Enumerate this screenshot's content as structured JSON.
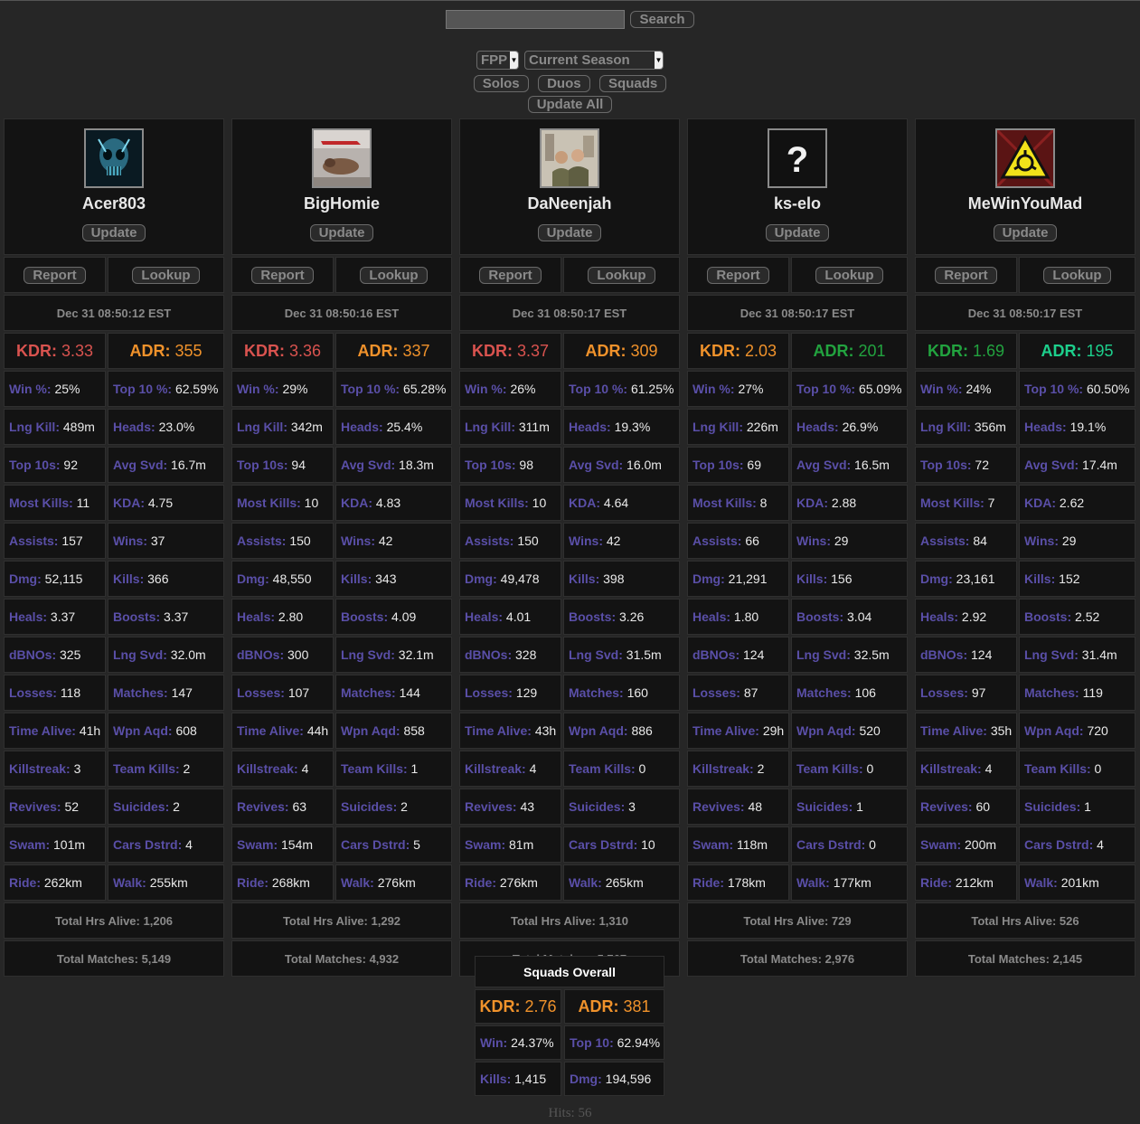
{
  "search": {
    "placeholder": "",
    "button": "Search"
  },
  "filters": {
    "perspective": "FPP",
    "season": "Current Season",
    "modes": [
      "Solos",
      "Duos",
      "Squads"
    ],
    "update_all": "Update All"
  },
  "labels": {
    "update": "Update",
    "report": "Report",
    "lookup": "Lookup",
    "kdr": "KDR:",
    "adr": "ADR:",
    "total_hrs_prefix": "Total Hrs Alive:",
    "total_matches_prefix": "Total Matches:"
  },
  "players": [
    {
      "name": "Acer803",
      "avatar": "skull-avatar",
      "updated": "Dec 31 08:50:12 EST",
      "kdr": "3.33",
      "adr": "355",
      "kdr_color": "#d9534f",
      "adr_color": "#f0922b",
      "stats": [
        [
          "Win %:",
          "25%",
          "Top 10 %:",
          "62.59%"
        ],
        [
          "Lng Kill:",
          "489m",
          "Heads:",
          "23.0%"
        ],
        [
          "Top 10s:",
          "92",
          "Avg Svd:",
          "16.7m"
        ],
        [
          "Most Kills:",
          "11",
          "KDA:",
          "4.75"
        ],
        [
          "Assists:",
          "157",
          "Wins:",
          "37"
        ],
        [
          "Dmg:",
          "52,115",
          "Kills:",
          "366"
        ],
        [
          "Heals:",
          "3.37",
          "Boosts:",
          "3.37"
        ],
        [
          "dBNOs:",
          "325",
          "Lng Svd:",
          "32.0m"
        ],
        [
          "Losses:",
          "118",
          "Matches:",
          "147"
        ],
        [
          "Time Alive:",
          "41h",
          "Wpn Aqd:",
          "608"
        ],
        [
          "Killstreak:",
          "3",
          "Team Kills:",
          "2"
        ],
        [
          "Revives:",
          "52",
          "Suicides:",
          "2"
        ],
        [
          "Swam:",
          "101m",
          "Cars Dstrd:",
          "4"
        ],
        [
          "Ride:",
          "262km",
          "Walk:",
          "255km"
        ]
      ],
      "total_hrs": "1,206",
      "total_matches": "5,149"
    },
    {
      "name": "BigHomie",
      "avatar": "photo-avatar",
      "updated": "Dec 31 08:50:16 EST",
      "kdr": "3.36",
      "adr": "337",
      "kdr_color": "#d9534f",
      "adr_color": "#f0922b",
      "stats": [
        [
          "Win %:",
          "29%",
          "Top 10 %:",
          "65.28%"
        ],
        [
          "Lng Kill:",
          "342m",
          "Heads:",
          "25.4%"
        ],
        [
          "Top 10s:",
          "94",
          "Avg Svd:",
          "18.3m"
        ],
        [
          "Most Kills:",
          "10",
          "KDA:",
          "4.83"
        ],
        [
          "Assists:",
          "150",
          "Wins:",
          "42"
        ],
        [
          "Dmg:",
          "48,550",
          "Kills:",
          "343"
        ],
        [
          "Heals:",
          "2.80",
          "Boosts:",
          "4.09"
        ],
        [
          "dBNOs:",
          "300",
          "Lng Svd:",
          "32.1m"
        ],
        [
          "Losses:",
          "107",
          "Matches:",
          "144"
        ],
        [
          "Time Alive:",
          "44h",
          "Wpn Aqd:",
          "858"
        ],
        [
          "Killstreak:",
          "4",
          "Team Kills:",
          "1"
        ],
        [
          "Revives:",
          "63",
          "Suicides:",
          "2"
        ],
        [
          "Swam:",
          "154m",
          "Cars Dstrd:",
          "5"
        ],
        [
          "Ride:",
          "268km",
          "Walk:",
          "276km"
        ]
      ],
      "total_hrs": "1,292",
      "total_matches": "4,932"
    },
    {
      "name": "DaNeenjah",
      "avatar": "soldiers-avatar",
      "updated": "Dec 31 08:50:17 EST",
      "kdr": "3.37",
      "adr": "309",
      "kdr_color": "#d9534f",
      "adr_color": "#f0922b",
      "stats": [
        [
          "Win %:",
          "26%",
          "Top 10 %:",
          "61.25%"
        ],
        [
          "Lng Kill:",
          "311m",
          "Heads:",
          "19.3%"
        ],
        [
          "Top 10s:",
          "98",
          "Avg Svd:",
          "16.0m"
        ],
        [
          "Most Kills:",
          "10",
          "KDA:",
          "4.64"
        ],
        [
          "Assists:",
          "150",
          "Wins:",
          "42"
        ],
        [
          "Dmg:",
          "49,478",
          "Kills:",
          "398"
        ],
        [
          "Heals:",
          "4.01",
          "Boosts:",
          "3.26"
        ],
        [
          "dBNOs:",
          "328",
          "Lng Svd:",
          "31.5m"
        ],
        [
          "Losses:",
          "129",
          "Matches:",
          "160"
        ],
        [
          "Time Alive:",
          "43h",
          "Wpn Aqd:",
          "886"
        ],
        [
          "Killstreak:",
          "4",
          "Team Kills:",
          "0"
        ],
        [
          "Revives:",
          "43",
          "Suicides:",
          "3"
        ],
        [
          "Swam:",
          "81m",
          "Cars Dstrd:",
          "10"
        ],
        [
          "Ride:",
          "276km",
          "Walk:",
          "265km"
        ]
      ],
      "total_hrs": "1,310",
      "total_matches": "5,767"
    },
    {
      "name": "ks-elo",
      "avatar": "question-mark-avatar",
      "updated": "Dec 31 08:50:17 EST",
      "kdr": "2.03",
      "adr": "201",
      "kdr_color": "#f0922b",
      "adr_color": "#22a33f",
      "stats": [
        [
          "Win %:",
          "27%",
          "Top 10 %:",
          "65.09%"
        ],
        [
          "Lng Kill:",
          "226m",
          "Heads:",
          "26.9%"
        ],
        [
          "Top 10s:",
          "69",
          "Avg Svd:",
          "16.5m"
        ],
        [
          "Most Kills:",
          "8",
          "KDA:",
          "2.88"
        ],
        [
          "Assists:",
          "66",
          "Wins:",
          "29"
        ],
        [
          "Dmg:",
          "21,291",
          "Kills:",
          "156"
        ],
        [
          "Heals:",
          "1.80",
          "Boosts:",
          "3.04"
        ],
        [
          "dBNOs:",
          "124",
          "Lng Svd:",
          "32.5m"
        ],
        [
          "Losses:",
          "87",
          "Matches:",
          "106"
        ],
        [
          "Time Alive:",
          "29h",
          "Wpn Aqd:",
          "520"
        ],
        [
          "Killstreak:",
          "2",
          "Team Kills:",
          "0"
        ],
        [
          "Revives:",
          "48",
          "Suicides:",
          "1"
        ],
        [
          "Swam:",
          "118m",
          "Cars Dstrd:",
          "0"
        ],
        [
          "Ride:",
          "178km",
          "Walk:",
          "177km"
        ]
      ],
      "total_hrs": "729",
      "total_matches": "2,976"
    },
    {
      "name": "MeWinYouMad",
      "avatar": "hazard-avatar",
      "updated": "Dec 31 08:50:17 EST",
      "kdr": "1.69",
      "adr": "195",
      "kdr_color": "#22a33f",
      "adr_color": "#1dcf8c",
      "stats": [
        [
          "Win %:",
          "24%",
          "Top 10 %:",
          "60.50%"
        ],
        [
          "Lng Kill:",
          "356m",
          "Heads:",
          "19.1%"
        ],
        [
          "Top 10s:",
          "72",
          "Avg Svd:",
          "17.4m"
        ],
        [
          "Most Kills:",
          "7",
          "KDA:",
          "2.62"
        ],
        [
          "Assists:",
          "84",
          "Wins:",
          "29"
        ],
        [
          "Dmg:",
          "23,161",
          "Kills:",
          "152"
        ],
        [
          "Heals:",
          "2.92",
          "Boosts:",
          "2.52"
        ],
        [
          "dBNOs:",
          "124",
          "Lng Svd:",
          "31.4m"
        ],
        [
          "Losses:",
          "97",
          "Matches:",
          "119"
        ],
        [
          "Time Alive:",
          "35h",
          "Wpn Aqd:",
          "720"
        ],
        [
          "Killstreak:",
          "4",
          "Team Kills:",
          "0"
        ],
        [
          "Revives:",
          "60",
          "Suicides:",
          "1"
        ],
        [
          "Swam:",
          "200m",
          "Cars Dstrd:",
          "4"
        ],
        [
          "Ride:",
          "212km",
          "Walk:",
          "201km"
        ]
      ],
      "total_hrs": "526",
      "total_matches": "2,145"
    }
  ],
  "overall": {
    "title": "Squads Overall",
    "kdr_label": "KDR:",
    "kdr": "2.76",
    "adr_label": "ADR:",
    "adr": "381",
    "win_label": "Win:",
    "win": "24.37%",
    "top10_label": "Top 10:",
    "top10": "62.94%",
    "kills_label": "Kills:",
    "kills": "1,415",
    "dmg_label": "Dmg:",
    "dmg": "194,596"
  },
  "hits": "Hits: 56"
}
